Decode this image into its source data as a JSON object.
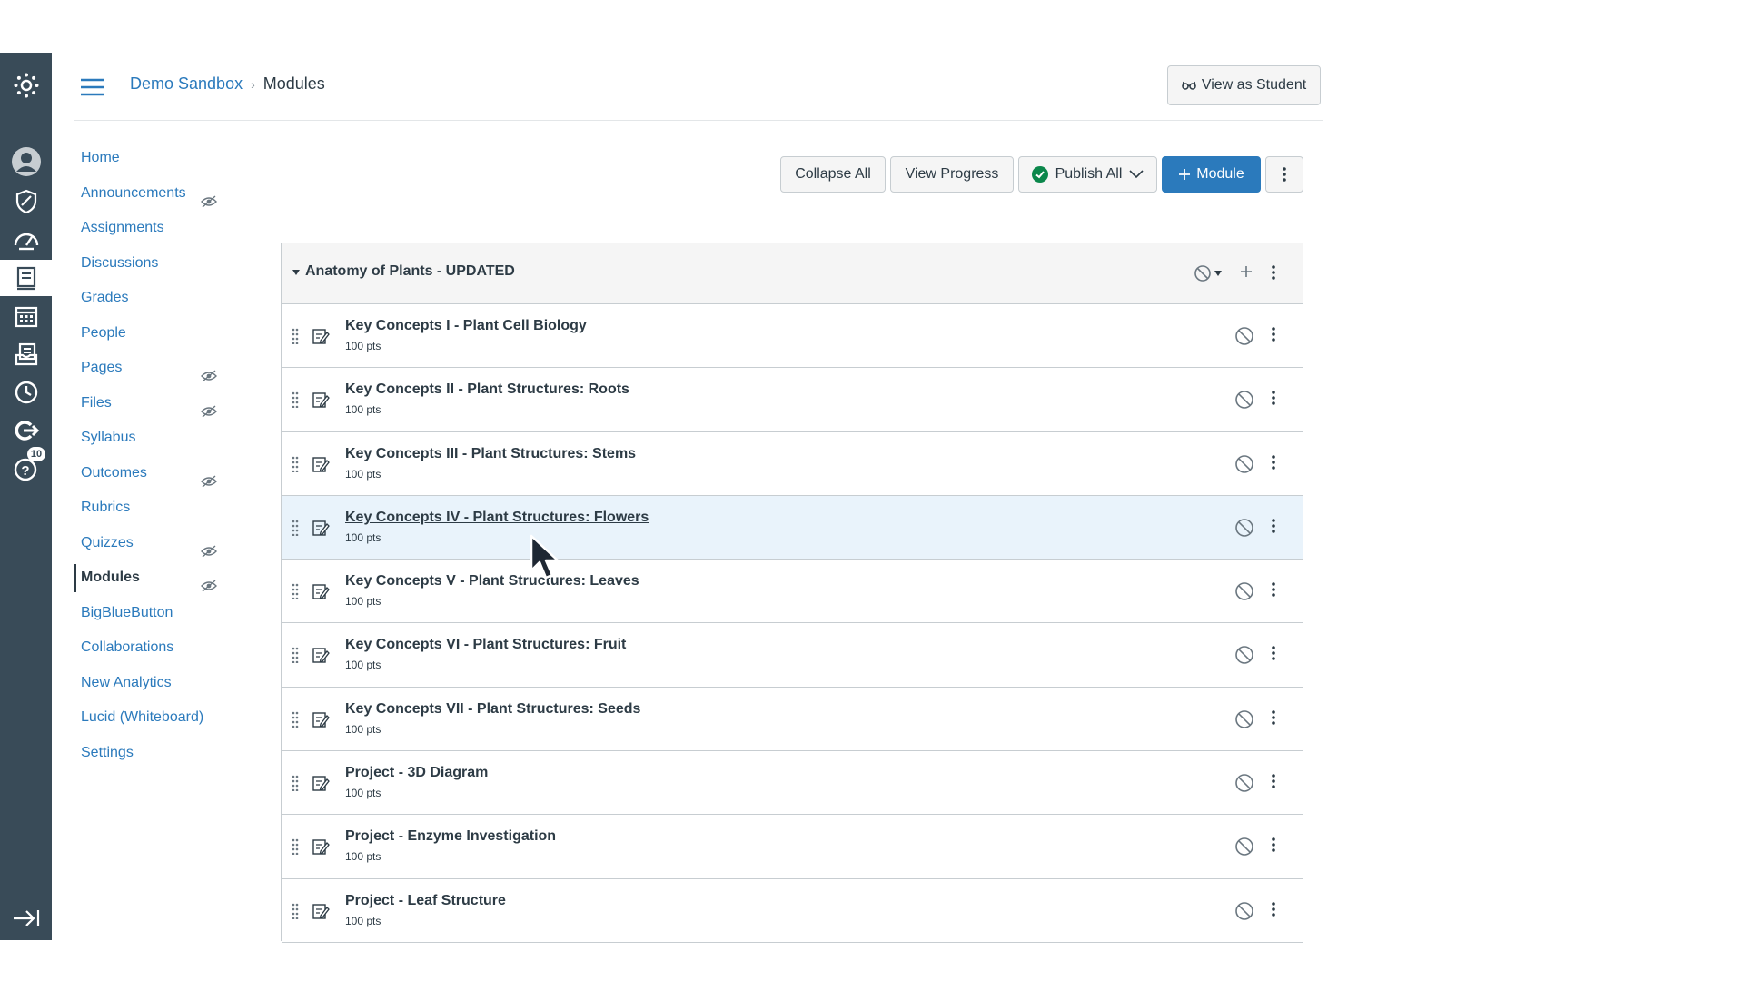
{
  "global_nav": {
    "icons": [
      {
        "name": "canvas-logo-icon"
      },
      {
        "name": "account-icon"
      },
      {
        "name": "admin-icon"
      },
      {
        "name": "dashboard-icon"
      },
      {
        "name": "courses-icon"
      },
      {
        "name": "calendar-icon"
      },
      {
        "name": "inbox-icon"
      },
      {
        "name": "history-icon"
      },
      {
        "name": "commons-icon"
      },
      {
        "name": "help-icon"
      }
    ],
    "help_badge": "10",
    "active_icon": "courses-icon",
    "collapse_icon": "collapse-nav-icon"
  },
  "header": {
    "breadcrumb": {
      "course": "Demo Sandbox",
      "current": "Modules"
    },
    "view_as_student": "View as Student"
  },
  "course_nav": {
    "items": [
      {
        "label": "Home",
        "hidden": false
      },
      {
        "label": "Announcements",
        "hidden": true
      },
      {
        "label": "Assignments",
        "hidden": false
      },
      {
        "label": "Discussions",
        "hidden": false
      },
      {
        "label": "Grades",
        "hidden": false
      },
      {
        "label": "People",
        "hidden": false
      },
      {
        "label": "Pages",
        "hidden": true
      },
      {
        "label": "Files",
        "hidden": true
      },
      {
        "label": "Syllabus",
        "hidden": false
      },
      {
        "label": "Outcomes",
        "hidden": true
      },
      {
        "label": "Rubrics",
        "hidden": false
      },
      {
        "label": "Quizzes",
        "hidden": true
      },
      {
        "label": "Modules",
        "hidden": true,
        "active": true
      },
      {
        "label": "BigBlueButton",
        "hidden": false
      },
      {
        "label": "Collaborations",
        "hidden": false
      },
      {
        "label": "New Analytics",
        "hidden": false
      },
      {
        "label": "Lucid (Whiteboard)",
        "hidden": false
      },
      {
        "label": "Settings",
        "hidden": false
      }
    ]
  },
  "toolbar": {
    "collapse_all": "Collapse All",
    "view_progress": "View Progress",
    "publish_all": "Publish All",
    "add_module": "Module"
  },
  "module": {
    "title": "Anatomy of Plants - UPDATED",
    "items": [
      {
        "title": "Key Concepts I - Plant Cell Biology",
        "points": "100 pts"
      },
      {
        "title": "Key Concepts II - Plant Structures: Roots",
        "points": "100 pts"
      },
      {
        "title": "Key Concepts III - Plant Structures: Stems",
        "points": "100 pts"
      },
      {
        "title": "Key Concepts IV - Plant Structures: Flowers",
        "points": "100 pts",
        "hovered": true
      },
      {
        "title": "Key Concepts V - Plant Structures: Leaves",
        "points": "100 pts"
      },
      {
        "title": "Key Concepts VI - Plant Structures: Fruit",
        "points": "100 pts"
      },
      {
        "title": "Key Concepts VII - Plant Structures: Seeds",
        "points": "100 pts"
      },
      {
        "title": "Project - 3D Diagram",
        "points": "100 pts"
      },
      {
        "title": "Project - Enzyme Investigation",
        "points": "100 pts"
      },
      {
        "title": "Project - Leaf Structure",
        "points": "100 pts"
      }
    ]
  },
  "colors": {
    "nav_bg": "#394b58",
    "link": "#2b7abc",
    "primary_button": "#2b7abc",
    "publish_green": "#0b874b",
    "hover_row": "#e9f3fb"
  }
}
